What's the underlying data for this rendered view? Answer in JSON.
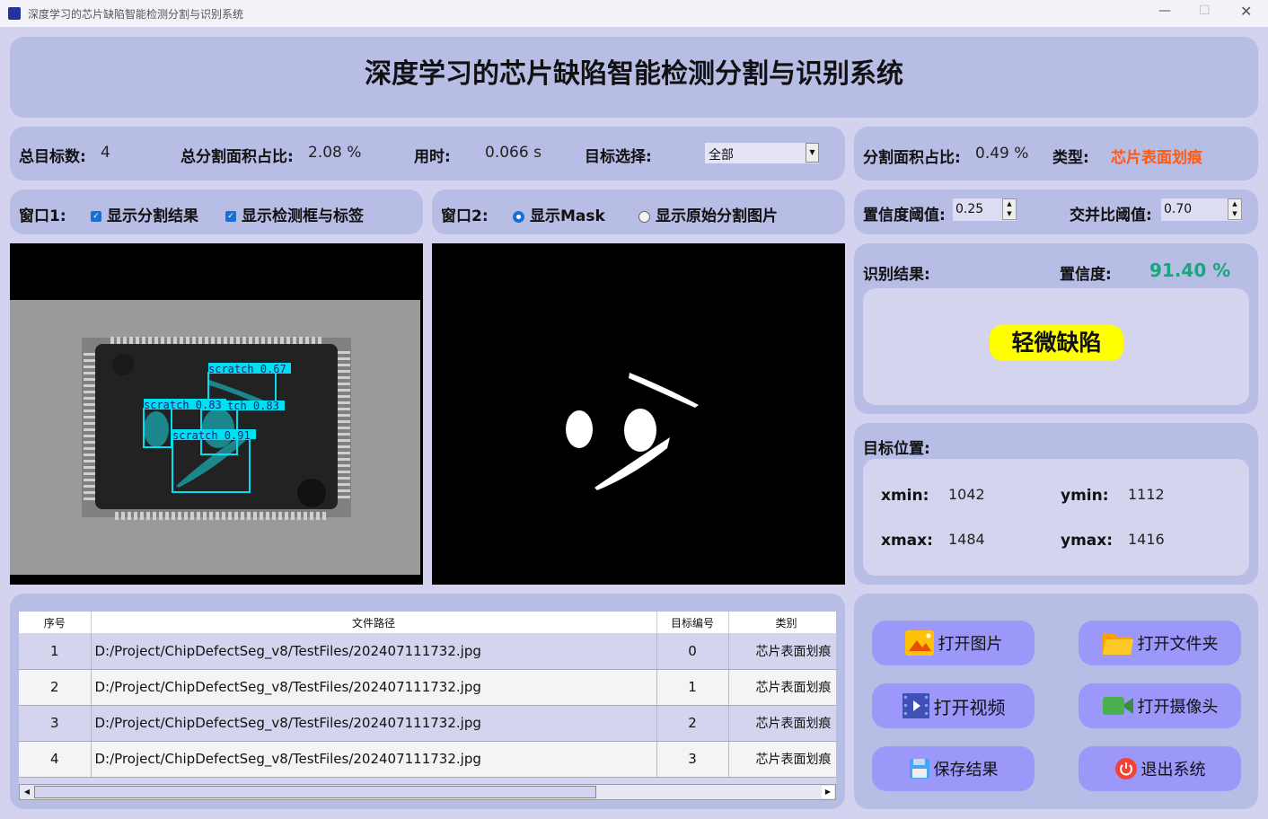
{
  "window": {
    "title": "深度学习的芯片缺陷智能检测分割与识别系统"
  },
  "header": {
    "title": "深度学习的芯片缺陷智能检测分割与识别系统"
  },
  "stats": {
    "total_label": "总目标数:",
    "total": "4",
    "area_label": "总分割面积占比:",
    "area": "2.08 %",
    "time_label": "用时:",
    "time": "0.066 s",
    "target_label": "目标选择:",
    "target_value": "全部"
  },
  "seg": {
    "area_label": "分割面积占比:",
    "area": "0.49 %",
    "type_label": "类型:",
    "type": "芯片表面划痕"
  },
  "window1": {
    "label": "窗口1:",
    "opt1": "显示分割结果",
    "opt2": "显示检测框与标签"
  },
  "window2": {
    "label": "窗口2:",
    "opt1": "显示Mask",
    "opt2": "显示原始分割图片"
  },
  "thresholds": {
    "conf_label": "置信度阈值:",
    "conf": "0.25",
    "iou_label": "交并比阈值:",
    "iou": "0.70"
  },
  "detections": [
    "scratch  0.67",
    "scratch  0.83",
    "tch  0.83",
    "scratch  0.91"
  ],
  "result": {
    "label": "识别结果:",
    "conf_label": "置信度:",
    "conf": "91.40 %",
    "value": "轻微缺陷"
  },
  "position": {
    "label": "目标位置:",
    "xmin_label": "xmin:",
    "xmin": "1042",
    "ymin_label": "ymin:",
    "ymin": "1112",
    "xmax_label": "xmax:",
    "xmax": "1484",
    "ymax_label": "ymax:",
    "ymax": "1416"
  },
  "table": {
    "headers": [
      "序号",
      "文件路径",
      "目标编号",
      "类别"
    ],
    "rows": [
      [
        "1",
        "D:/Project/ChipDefectSeg_v8/TestFiles/202407111732.jpg",
        "0",
        "芯片表面划痕"
      ],
      [
        "2",
        "D:/Project/ChipDefectSeg_v8/TestFiles/202407111732.jpg",
        "1",
        "芯片表面划痕"
      ],
      [
        "3",
        "D:/Project/ChipDefectSeg_v8/TestFiles/202407111732.jpg",
        "2",
        "芯片表面划痕"
      ],
      [
        "4",
        "D:/Project/ChipDefectSeg_v8/TestFiles/202407111732.jpg",
        "3",
        "芯片表面划痕"
      ]
    ]
  },
  "buttons": {
    "open_image": "打开图片",
    "open_folder": "打开文件夹",
    "open_video": "打开视频",
    "open_camera": "打开摄像头",
    "save": "保存结果",
    "exit": "退出系统"
  },
  "colors": {
    "type": "#ff5a10",
    "conf": "#14a87a",
    "badge": "#ffff00",
    "button": "#9b98fa",
    "panel": "#b8bde6"
  }
}
